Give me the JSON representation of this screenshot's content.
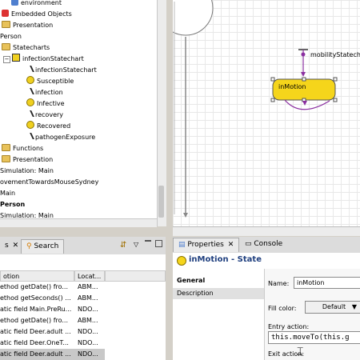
{
  "tree": {
    "items": [
      {
        "label": "environment",
        "icon": "environment-icon"
      },
      {
        "label": "Embedded Objects",
        "icon": "embedded-objects-icon"
      },
      {
        "label": "Presentation",
        "icon": "presentation-icon"
      },
      {
        "label": "Person",
        "icon": "person-icon"
      },
      {
        "label": "Statecharts",
        "icon": "statecharts-icon"
      },
      {
        "label": "infectionStatechart",
        "icon": "statechart-icon"
      },
      {
        "label": "infectionStatechart",
        "icon": "statechart-entry-icon"
      },
      {
        "label": "Susceptible",
        "icon": "state-icon"
      },
      {
        "label": "infection",
        "icon": "transition-icon"
      },
      {
        "label": "Infective",
        "icon": "state-icon"
      },
      {
        "label": "recovery",
        "icon": "transition-icon"
      },
      {
        "label": "Recovered",
        "icon": "state-icon"
      },
      {
        "label": "pathogenExposure",
        "icon": "transition-icon"
      },
      {
        "label": "Functions",
        "icon": "functions-icon"
      },
      {
        "label": "Presentation",
        "icon": "presentation-icon"
      },
      {
        "label": "Simulation: Main",
        "icon": "simulation-icon"
      },
      {
        "label": "ovementTowardsMouseSydney",
        "icon": ""
      },
      {
        "label": "Main",
        "icon": ""
      },
      {
        "label": "Person",
        "icon": ""
      },
      {
        "label": "Simulation: Main",
        "icon": ""
      }
    ]
  },
  "canvas": {
    "statechart_label": "mobilityStatech",
    "state_label": "inMotion"
  },
  "results_panel": {
    "tab_left": "s",
    "tab_search": "Search",
    "columns": [
      "otion",
      "Locat..."
    ],
    "rows": [
      {
        "desc": "ethod getDate() fro...",
        "loc": "ABM..."
      },
      {
        "desc": "ethod getSeconds() ...",
        "loc": "ABM..."
      },
      {
        "desc": "atic field Main.PreRu...",
        "loc": "NDO..."
      },
      {
        "desc": "ethod getDate() fro...",
        "loc": "ABM..."
      },
      {
        "desc": "atic field Deer.adult ...",
        "loc": "NDO..."
      },
      {
        "desc": "atic field Deer.OneT...",
        "loc": "NDO..."
      },
      {
        "desc": "atic field Deer.adult ...",
        "loc": "NDO..."
      }
    ]
  },
  "properties": {
    "tab_properties": "Properties",
    "tab_console": "Console",
    "header": "inMotion - State",
    "sections": [
      "General",
      "Description"
    ],
    "name_label": "Name:",
    "name_value": "inMotion",
    "fill_color_label": "Fill color:",
    "fill_color_value": "Default",
    "entry_action_label": "Entry action:",
    "entry_action_value": "this.moveTo(this.g",
    "exit_action_label": "Exit action:"
  },
  "colors": {
    "state_fill": "#f5d51b",
    "transition": "#8a2ea0"
  }
}
